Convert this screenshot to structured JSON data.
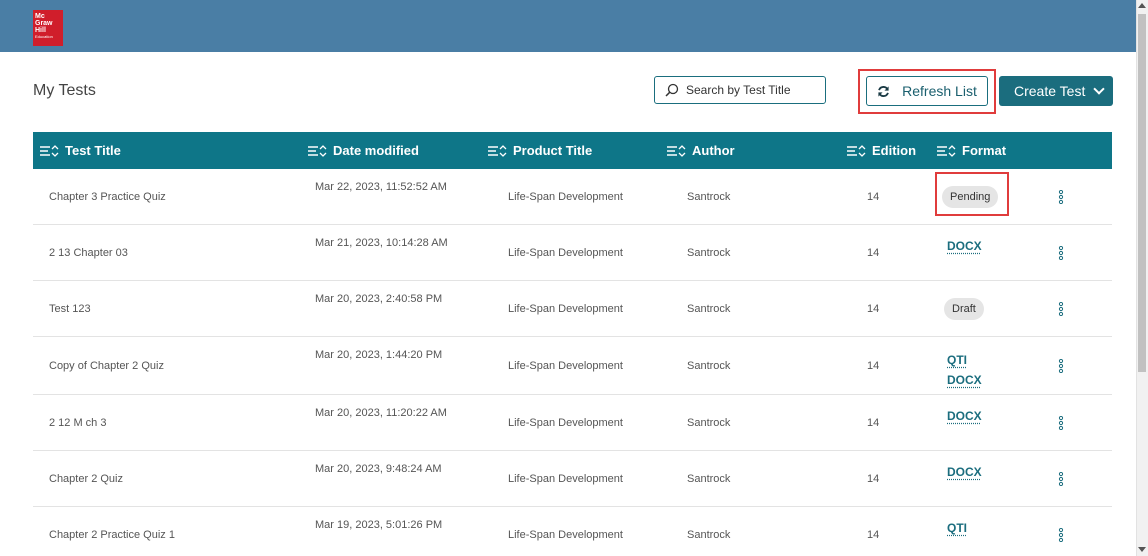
{
  "brand": {
    "logo_lines": [
      "Mc",
      "Graw",
      "Hill",
      "Education"
    ]
  },
  "page": {
    "title": "My Tests"
  },
  "search": {
    "placeholder": "Search by Test Title"
  },
  "actions": {
    "refresh_label": "Refresh List",
    "create_label": "Create Test"
  },
  "table": {
    "headers": [
      "Test Title",
      "Date modified",
      "Product Title",
      "Author",
      "Edition",
      "Format"
    ],
    "rows": [
      {
        "title": "Chapter 3 Practice Quiz",
        "date": "Mar 22, 2023, 11:52:52 AM",
        "product": "Life-Span Development",
        "author": "Santrock",
        "edition": "14",
        "formats": [
          "Pending"
        ],
        "format_kind": "badge"
      },
      {
        "title": "2 13 Chapter 03",
        "date": "Mar 21, 2023, 10:14:28 AM",
        "product": "Life-Span Development",
        "author": "Santrock",
        "edition": "14",
        "formats": [
          "DOCX"
        ],
        "format_kind": "link"
      },
      {
        "title": "Test 123",
        "date": "Mar 20, 2023, 2:40:58 PM",
        "product": "Life-Span Development",
        "author": "Santrock",
        "edition": "14",
        "formats": [
          "Draft"
        ],
        "format_kind": "badge"
      },
      {
        "title": "Copy of Chapter 2 Quiz",
        "date": "Mar 20, 2023, 1:44:20 PM",
        "product": "Life-Span Development",
        "author": "Santrock",
        "edition": "14",
        "formats": [
          "QTI",
          "DOCX"
        ],
        "format_kind": "link"
      },
      {
        "title": "2 12 M ch 3",
        "date": "Mar 20, 2023, 11:20:22 AM",
        "product": "Life-Span Development",
        "author": "Santrock",
        "edition": "14",
        "formats": [
          "DOCX"
        ],
        "format_kind": "link"
      },
      {
        "title": "Chapter 2 Quiz",
        "date": "Mar 20, 2023, 9:48:24 AM",
        "product": "Life-Span Development",
        "author": "Santrock",
        "edition": "14",
        "formats": [
          "DOCX"
        ],
        "format_kind": "link"
      },
      {
        "title": "Chapter 2 Practice Quiz 1",
        "date": "Mar 19, 2023, 5:01:26 PM",
        "product": "Life-Span Development",
        "author": "Santrock",
        "edition": "14",
        "formats": [
          "QTI"
        ],
        "format_kind": "link"
      }
    ]
  },
  "colors": {
    "topbar": "#4a7ea5",
    "teal": "#0e7688",
    "button": "#1b6d7e",
    "highlight": "#e03c3c",
    "logo_red": "#d01e2b"
  },
  "icons": {
    "search": "search-icon",
    "refresh": "refresh-icon",
    "sort": "sort-icon",
    "menu": "kebab-menu-icon",
    "chevron": "chevron-down-icon"
  }
}
